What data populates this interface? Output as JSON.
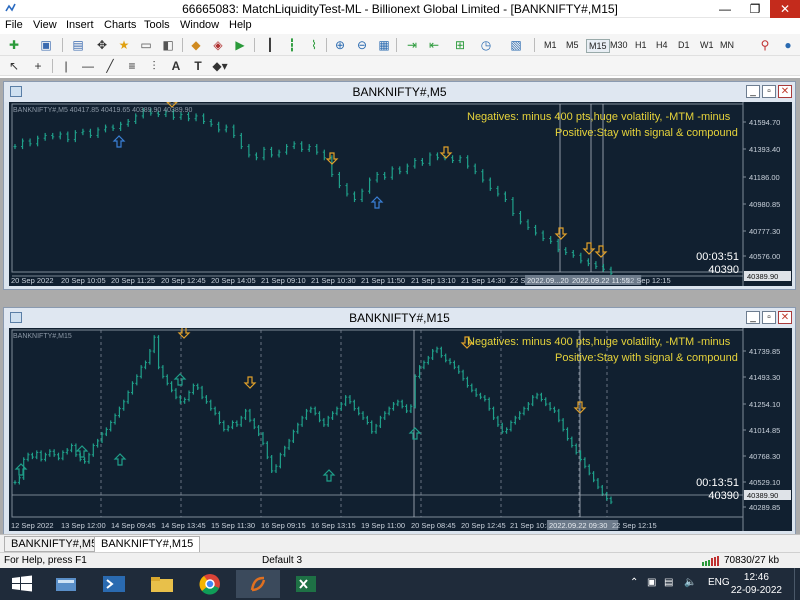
{
  "window": {
    "title": "66665083: MatchLiquidityTest-ML - Billionext Global Limited - [BANKNIFTY#,M15]",
    "minimize": "—",
    "restore": "❐",
    "close": "✕"
  },
  "menu": [
    "File",
    "View",
    "Insert",
    "Charts",
    "Tools",
    "Window",
    "Help"
  ],
  "timeframes": [
    "M1",
    "M5",
    "M15",
    "M30",
    "H1",
    "H4",
    "D1",
    "W1",
    "MN"
  ],
  "active_timeframe": "M15",
  "toolbar2_letters": {
    "text": "A",
    "label": "T"
  },
  "charts": [
    {
      "window_title": "BANKNIFTY#,M5",
      "info": "BANKNIFTY#,M5  40417.85 40419.65 40389.90 40389.90",
      "note1": "Negatives: minus 400 pts,huge volatility, -MTM -minus",
      "note2": "Positive:Stay with signal & compound",
      "timer": "00:03:51",
      "price": "40390",
      "price_tag": "40389.90",
      "y_ticks": [
        "41594.70",
        "41393.40",
        "41186.00",
        "40980.85",
        "40777.30",
        "40576.00"
      ],
      "x_ticks": [
        "20 Sep 2022",
        "20 Sep 10:05",
        "20 Sep 11:25",
        "20 Sep 12:45",
        "20 Sep 14:05",
        "21 Sep 09:10",
        "21 Sep 10:30",
        "21 Sep 11:50",
        "21 Sep 13:10",
        "21 Sep 14:30",
        "22 S",
        "2022.09...20",
        "2022.09.22 11:55",
        "22 Sep 12:15"
      ],
      "chart_data": {
        "type": "bar",
        "symbol": "BANKNIFTY#",
        "timeframe": "M5",
        "ylim": [
          40480,
          41700
        ],
        "closes": [
          41380,
          41420,
          41400,
          41440,
          41460,
          41450,
          41470,
          41430,
          41480,
          41490,
          41460,
          41500,
          41520,
          41510,
          41540,
          41560,
          41600,
          41640,
          41620,
          41610,
          41630,
          41590,
          41610,
          41580,
          41600,
          41560,
          41540,
          41500,
          41520,
          41460,
          41380,
          41320,
          41300,
          41360,
          41320,
          41340,
          41380,
          41400,
          41360,
          41380,
          41340,
          41300,
          41180,
          41100,
          41040,
          41000,
          41060,
          41140,
          41180,
          41160,
          41220,
          41200,
          41240,
          41280,
          41260,
          41320,
          41300,
          41300,
          41280,
          41300,
          41240,
          41200,
          41140,
          41080,
          41040,
          41000,
          40900,
          40840,
          40800,
          40760,
          40720,
          40700,
          40640,
          40620,
          40600,
          40560,
          40540,
          40520,
          40500,
          40470
        ]
      }
    },
    {
      "window_title": "BANKNIFTY#,M15",
      "info": "BANKNIFTY#,M15",
      "note1": "Negatives: minus 400 pts,huge volatility, -MTM -minus",
      "note2": "Positive:Stay with signal & compound",
      "timer": "00:13:51",
      "price": "40390",
      "price_tag": "40389.90",
      "y_ticks": [
        "41739.85",
        "41493.30",
        "41254.10",
        "41014.85",
        "40768.30",
        "40529.10",
        "40289.85"
      ],
      "x_ticks": [
        "12 Sep 2022",
        "13 Sep 12:00",
        "14 Sep 09:45",
        "14 Sep 13:45",
        "15 Sep 11:30",
        "16 Sep 09:15",
        "16 Sep 13:15",
        "19 Sep 11:00",
        "20 Sep 08:45",
        "20 Sep 12:45",
        "21 Sep 10:3",
        "2022.09.22 09:30",
        "22 Sep 12:15"
      ],
      "chart_data": {
        "type": "bar",
        "symbol": "BANKNIFTY#",
        "timeframe": "M15",
        "ylim": [
          40260,
          41900
        ],
        "closes": [
          40560,
          40600,
          40760,
          40800,
          40780,
          40820,
          40760,
          40800,
          40830,
          40800,
          40770,
          40820,
          40840,
          40880,
          40800,
          40760,
          40740,
          40800,
          40880,
          40920,
          40980,
          41020,
          41080,
          41140,
          41200,
          41260,
          41340,
          41420,
          41480,
          41560,
          41600,
          41700,
          41820,
          41560,
          41480,
          41420,
          41360,
          41300,
          41260,
          41280,
          41340,
          41400,
          41380,
          41300,
          41260,
          41200,
          41160,
          41080,
          41020,
          41040,
          41080,
          41060,
          41120,
          41180,
          41100,
          41040,
          40980,
          40900,
          40780,
          40660,
          40700,
          40800,
          40860,
          40920,
          41000,
          41060,
          41120,
          41180,
          41200,
          41160,
          41100,
          41060,
          41120,
          41160,
          41200,
          41240,
          41300,
          41260,
          41200,
          41160,
          41120,
          41080,
          41000,
          41050,
          41120,
          41160,
          41200,
          41240,
          41260,
          41220,
          41180,
          41220,
          41480,
          41560,
          41600,
          41640,
          41700,
          41720,
          41660,
          41620,
          41600,
          41560,
          41520,
          41460,
          41400,
          41360,
          41320,
          41300,
          41280,
          41200,
          41120,
          41060,
          41000,
          41020,
          41080,
          41120,
          41160,
          41200,
          41240,
          41300,
          41320,
          41280,
          41240,
          41200,
          41180,
          41100,
          41020,
          40940,
          40880,
          40820,
          40760,
          40700,
          40640,
          40580,
          40520,
          40460,
          40420,
          40390
        ]
      }
    }
  ],
  "tabs": [
    "BANKNIFTY#,M5",
    "BANKNIFTY#,M15"
  ],
  "active_tab": "BANKNIFTY#,M15",
  "status": {
    "help": "For Help, press F1",
    "profile": "Default 3",
    "traffic": "70830/27 kb"
  },
  "taskbar": {
    "lang": "ENG",
    "time": "12:46",
    "date": "22-09-2022"
  },
  "colors": {
    "chart_bg": "#112030",
    "bars": "#1fa08a",
    "note_text": "#e6d33b",
    "arrow_up": "#3a7fd6",
    "arrow_down": "#e0a02a"
  }
}
